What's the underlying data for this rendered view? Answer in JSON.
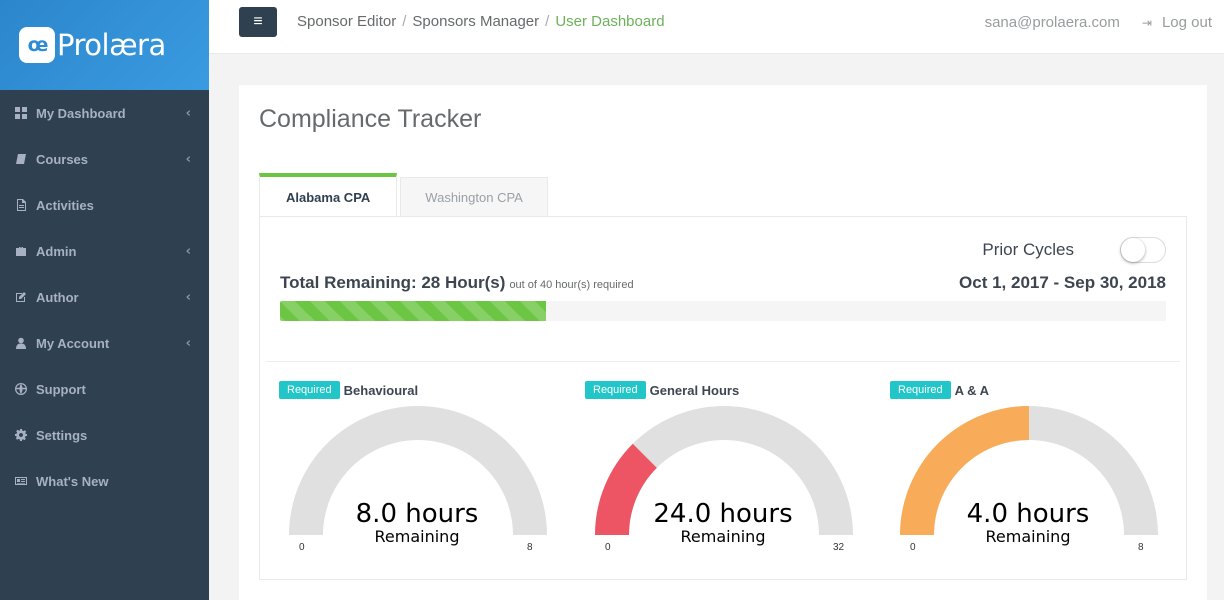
{
  "brand": {
    "mark": "œ",
    "name": "Prolæra"
  },
  "sidebar": {
    "items": [
      {
        "label": "My Dashboard",
        "icon": "dashboard-icon",
        "has_submenu": true
      },
      {
        "label": "Courses",
        "icon": "book-icon",
        "has_submenu": true
      },
      {
        "label": "Activities",
        "icon": "file-icon",
        "has_submenu": false
      },
      {
        "label": "Admin",
        "icon": "briefcase-icon",
        "has_submenu": true
      },
      {
        "label": "Author",
        "icon": "edit-icon",
        "has_submenu": true
      },
      {
        "label": "My Account",
        "icon": "user-icon",
        "has_submenu": true
      },
      {
        "label": "Support",
        "icon": "globe-icon",
        "has_submenu": false
      },
      {
        "label": "Settings",
        "icon": "gear-icon",
        "has_submenu": false
      },
      {
        "label": "What's New",
        "icon": "newspaper-icon",
        "has_submenu": false
      }
    ],
    "chevron": "‹"
  },
  "topbar": {
    "menu_icon": "≡",
    "breadcrumbs": [
      "Sponsor Editor",
      "Sponsors Manager",
      "User Dashboard"
    ],
    "separator": "/",
    "email": "sana@prolaera.com",
    "logout_label": "Log out",
    "logout_icon": "⇥"
  },
  "main": {
    "title": "Compliance Tracker",
    "tabs": [
      {
        "label": "Alabama CPA",
        "active": true
      },
      {
        "label": "Washington CPA",
        "active": false
      }
    ],
    "prior_cycles_label": "Prior Cycles",
    "prior_cycles_on": false,
    "total_remaining_label": "Total Remaining: 28 Hour(s)",
    "total_required_label": "out of 40 hour(s) required",
    "cycle_range": "Oct 1, 2017 - Sep 30, 2018",
    "progress_fraction": 0.3,
    "progress_color": "#6cc644"
  },
  "gauges": [
    {
      "badge": "Required",
      "title": "Behavioural",
      "value_label": "8.0 hours",
      "unit_label": "Remaining",
      "min": "0",
      "max": "8",
      "completed_fraction": 0.0,
      "color": "#ed5565"
    },
    {
      "badge": "Required",
      "title": "General Hours",
      "value_label": "24.0 hours",
      "unit_label": "Remaining",
      "min": "0",
      "max": "32",
      "completed_fraction": 0.25,
      "color": "#ed5565"
    },
    {
      "badge": "Required",
      "title": "A & A",
      "value_label": "4.0 hours",
      "unit_label": "Remaining",
      "min": "0",
      "max": "8",
      "completed_fraction": 0.5,
      "color": "#f8ac59"
    }
  ],
  "colors": {
    "sidebar_bg": "#2f4050",
    "accent_green": "#6cc644",
    "badge_teal": "#23c6c8",
    "gauge_track": "#e0e0e0"
  }
}
